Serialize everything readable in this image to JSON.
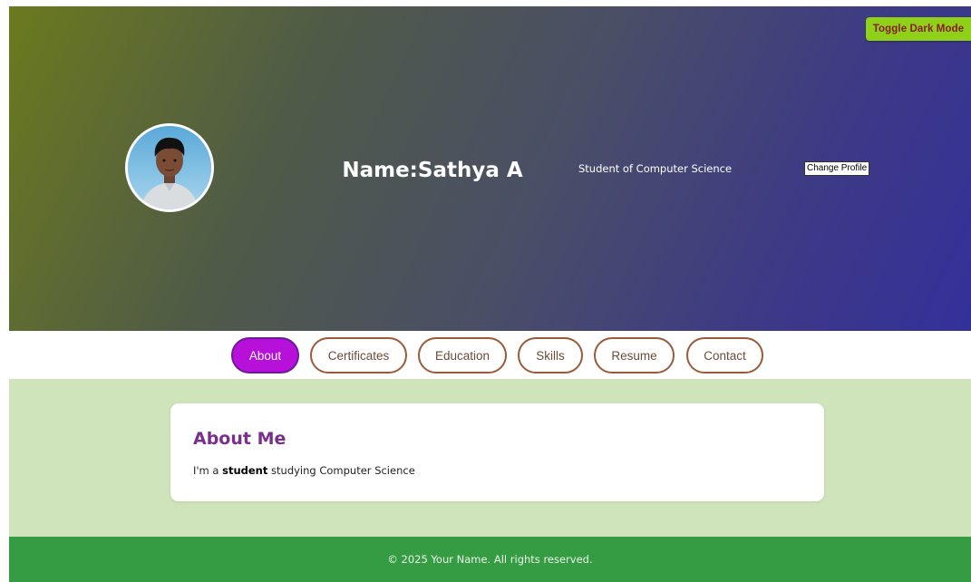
{
  "header": {
    "toggle_label": "Toggle Dark Mode",
    "name": "Name:Sathya A",
    "subtitle": "Student of Computer Science",
    "change_profile_label": "Change Profile",
    "avatar_icon": "profile-photo"
  },
  "nav": {
    "items": [
      {
        "label": "About",
        "active": true
      },
      {
        "label": "Certificates",
        "active": false
      },
      {
        "label": "Education",
        "active": false
      },
      {
        "label": "Skills",
        "active": false
      },
      {
        "label": "Resume",
        "active": false
      },
      {
        "label": "Contact",
        "active": false
      }
    ]
  },
  "about": {
    "heading": "About Me",
    "text_prefix": "I'm a ",
    "text_bold": "student",
    "text_suffix": " studying Computer Science"
  },
  "footer": {
    "text": "© 2025 Your Name. All rights reserved."
  },
  "colors": {
    "toggle_bg": "#8fd118",
    "active_nav_bg": "#b710d8",
    "nav_border": "#9c5a3a",
    "main_bg": "#cfe4ba",
    "heading_color": "#7a2e8e",
    "footer_bg": "#359c43"
  }
}
